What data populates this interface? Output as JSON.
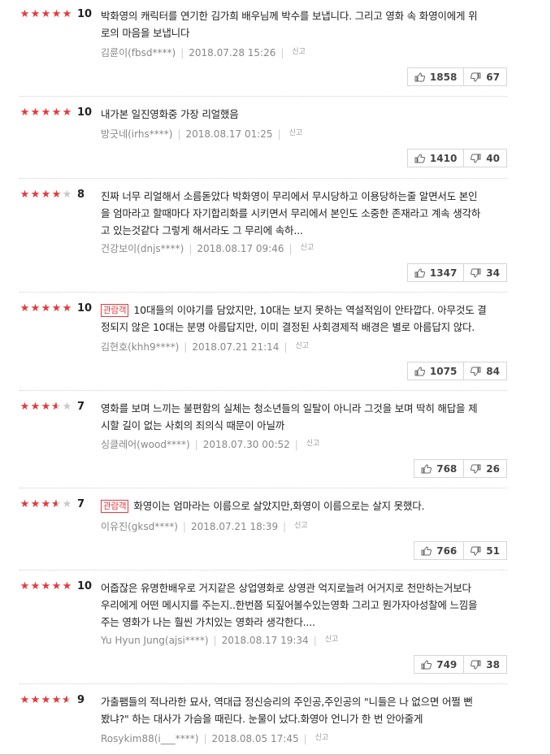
{
  "icons": {
    "like": "thumbs-up-icon",
    "dislike": "thumbs-down-icon",
    "star_color": "#e5383d"
  },
  "reviews": [
    {
      "stars": [
        1,
        1,
        1,
        1,
        1
      ],
      "score": "10",
      "badge": "",
      "lines": [
        "박화영의 캐릭터를 연기한 김가희 배우님께 박수를 보냅니다. 그리고 영화 속 화영이에게 위",
        "로의 마음을 보냅니다"
      ],
      "author": "김륜이(fbsd****)",
      "date": "2018.07.28 15:26",
      "report": "신고",
      "likes": "1858",
      "dislikes": "67"
    },
    {
      "stars": [
        1,
        1,
        1,
        1,
        1
      ],
      "score": "10",
      "badge": "",
      "lines": [
        "내가본 일진영화중 가장 리얼했음"
      ],
      "author": "방긋네(irhs****)",
      "date": "2018.08.17 01:25",
      "report": "신고",
      "likes": "1410",
      "dislikes": "40"
    },
    {
      "stars": [
        1,
        1,
        1,
        1,
        0
      ],
      "score": "8",
      "badge": "",
      "lines": [
        "진짜 너무 리얼해서 소름돋았다 박화영이 무리에서 무시당하고 이용당하는줄 알면서도 본인",
        "을 엄마라고 할때마다 자기합리화를 시키면서 무리에서 본인도 소중한 존재라고 계속 생각하",
        "고 있는것같다 그렇게 해서라도 그 무리에 속하..."
      ],
      "author": "건강보이(dnjs****)",
      "date": "2018.08.17 09:46",
      "report": "신고",
      "likes": "1347",
      "dislikes": "34"
    },
    {
      "stars": [
        1,
        1,
        1,
        1,
        1
      ],
      "score": "10",
      "badge": "관람객",
      "lines": [
        "10대들의 이야기를 담았지만, 10대는 보지 못하는 역설적임이 안타깝다. 아무것도 결",
        "정되지 않은 10대는 분명 아름답지만, 이미 결정된 사회경제적 배경은 별로 아름답지 않다."
      ],
      "author": "김현호(khh9****)",
      "date": "2018.07.21 21:14",
      "report": "신고",
      "likes": "1075",
      "dislikes": "84"
    },
    {
      "stars": [
        1,
        1,
        1,
        0.5,
        0
      ],
      "score": "7",
      "badge": "",
      "lines": [
        "영화를 보며 느끼는 불편함의 실체는 청소년들의 일탈이 아니라 그것을 보며 딱히 해답을 제",
        "시할 길이 없는 사회의 죄의식 때문이 아닐까"
      ],
      "author": "싱클레어(wood****)",
      "date": "2018.07.30 00:52",
      "report": "신고",
      "likes": "768",
      "dislikes": "26"
    },
    {
      "stars": [
        1,
        1,
        1,
        0.5,
        0
      ],
      "score": "7",
      "badge": "관람객",
      "lines": [
        "화영이는 엄마라는 이름으로 살았지만,화영이 이름으로는 살지 못했다."
      ],
      "author": "이유진(gksd****)",
      "date": "2018.07.21 18:39",
      "report": "신고",
      "likes": "766",
      "dislikes": "51"
    },
    {
      "stars": [
        1,
        1,
        1,
        1,
        1
      ],
      "score": "10",
      "badge": "",
      "lines": [
        "어줍잖은 유명한배우로 거지같은 상업영화로 상영관 억지로늘려 어거지로 천만하는거보다",
        "우리에게 어떤 메시지를 주는지..한번쯤 되짚어볼수있는영화 그리고 뭔가자아성찰에 느낌을",
        "주는 영화가 나는 훨씬 가치있는 영화라 생각한다...."
      ],
      "author": "Yu Hyun Jung(ajsi****)",
      "date": "2018.08.17 19:34",
      "report": "신고",
      "likes": "749",
      "dislikes": "38"
    },
    {
      "stars": [
        1,
        1,
        1,
        1,
        0.5
      ],
      "score": "9",
      "badge": "",
      "lines": [
        "가출팸들의 적나라한 묘사, 역대급 정신승리의 주인공,주인공의 \"니들은 나 없으면 어쩔 뻔",
        "봤냐?\" 하는 대사가 가슴을 때린다. 눈물이 났다.화영아 언니가 한 번 안아줄게"
      ],
      "author": "Rosykim88(i___****)",
      "date": "2018.08.05 17:45",
      "report": "신고",
      "likes": "",
      "dislikes": ""
    }
  ]
}
